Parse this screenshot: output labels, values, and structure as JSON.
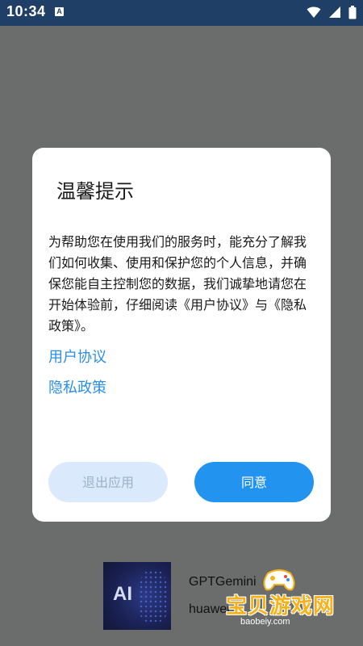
{
  "status_bar": {
    "time": "10:34",
    "notification_letter": "A",
    "icons": [
      "wifi-icon",
      "signal-icon",
      "battery-icon"
    ],
    "bg_color": "#1f3f67"
  },
  "background_app": {
    "thumbnail_label": "AI",
    "name": "GPTGemini",
    "developer": "huawei"
  },
  "watermark": {
    "text": "宝贝游戏网",
    "url": "baobeiy.com"
  },
  "dialog": {
    "title": "温馨提示",
    "body": "为帮助您在使用我们的服务时，能充分了解我们如何收集、使用和保护您的个人信息，并确保您能自主控制您的数据，我们诚挚地请您在开始体验前，仔细阅读《用户协议》与《隐私政策》。",
    "links": [
      {
        "label": "用户协议"
      },
      {
        "label": "隐私政策"
      }
    ],
    "buttons": {
      "exit_label": "退出应用",
      "agree_label": "同意"
    }
  },
  "colors": {
    "overlay": "#6b6d6d",
    "link": "#2a8ee6",
    "agree_button": "#2293ef",
    "exit_button": "#dbe9fc"
  }
}
